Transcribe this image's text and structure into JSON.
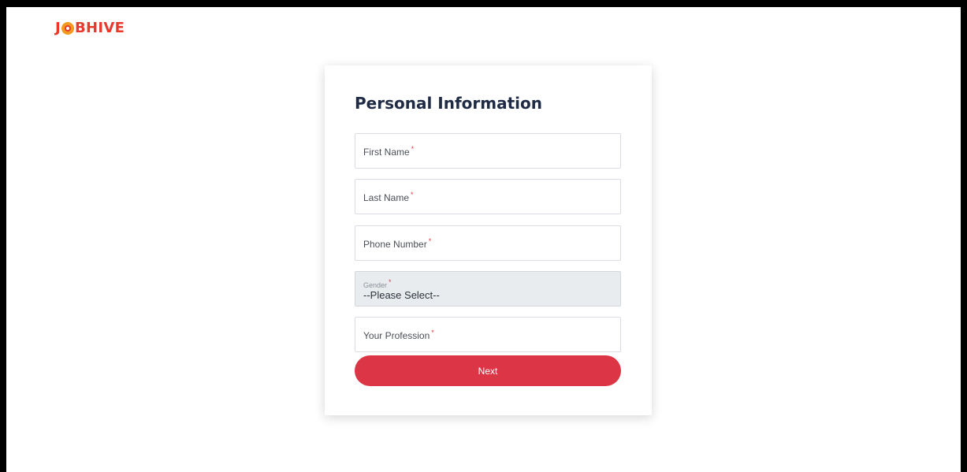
{
  "brand": {
    "logo_text_left": "J",
    "logo_text_right": "BHIVE",
    "logo_mark_icon": "target-bulb-icon",
    "color": "#e8392b"
  },
  "form": {
    "title": "Personal Information",
    "fields": [
      {
        "label": "First Name",
        "required_mark": "*",
        "value": ""
      },
      {
        "label": "Last Name",
        "required_mark": "*",
        "value": ""
      },
      {
        "label": "Phone Number",
        "required_mark": "*",
        "value": ""
      },
      {
        "label": "Gender",
        "required_mark": "*",
        "selected": "--Please Select--",
        "type": "select"
      },
      {
        "label": "Your Profession",
        "required_mark": "*",
        "value": ""
      }
    ],
    "next_label": "Next",
    "accent_color": "#dc3545"
  }
}
